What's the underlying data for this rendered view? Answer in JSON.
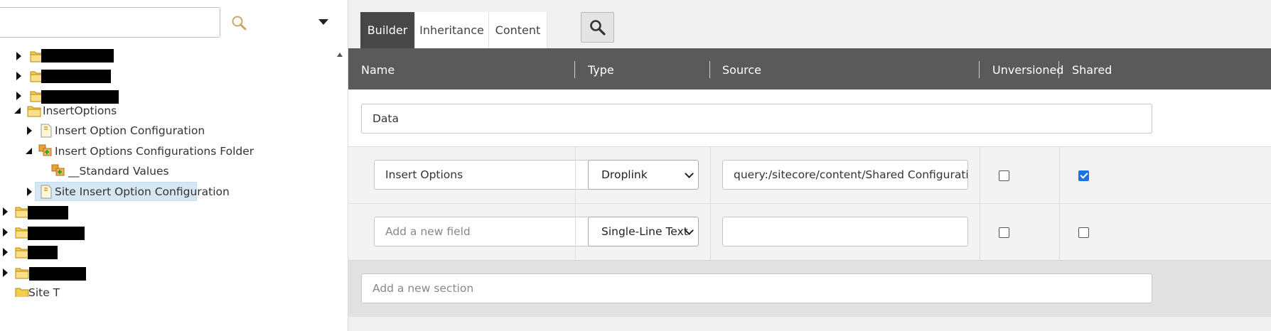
{
  "tree": {
    "search": {
      "value": "",
      "placeholder": ""
    },
    "items": [
      {
        "label": "",
        "redacted": true,
        "expanded": false
      },
      {
        "label": "",
        "redacted": true,
        "expanded": false
      },
      {
        "label": "",
        "redacted": true,
        "expanded": false
      },
      {
        "label": "InsertOptions",
        "redacted": false,
        "expanded": true
      },
      {
        "label": "Insert Option Configuration",
        "redacted": false,
        "expanded": false
      },
      {
        "label": "Insert Options Configurations Folder",
        "redacted": false,
        "expanded": true
      },
      {
        "label": "__Standard Values",
        "redacted": false,
        "expanded": false
      },
      {
        "label": "Site Insert Option Configuration",
        "redacted": false,
        "expanded": false,
        "selected": true
      },
      {
        "label": "",
        "redacted": true,
        "expanded": false
      },
      {
        "label": "",
        "redacted": true,
        "expanded": false
      },
      {
        "label": "",
        "redacted": true,
        "expanded": false
      },
      {
        "label": "",
        "redacted": true,
        "expanded": false
      },
      {
        "label": "Site T",
        "redacted": false,
        "expanded": false,
        "partial": true
      }
    ]
  },
  "tabs": [
    {
      "label": "Builder",
      "active": true
    },
    {
      "label": "Inheritance",
      "active": false
    },
    {
      "label": "Content",
      "active": false
    }
  ],
  "grid": {
    "columns": {
      "name": "Name",
      "type": "Type",
      "source": "Source",
      "unversioned": "Unversioned",
      "shared": "Shared"
    },
    "section": {
      "name": "Data"
    },
    "fields": [
      {
        "name": "Insert Options",
        "type": "Droplink",
        "source": "query:/sitecore/content/Shared Configuration/Head",
        "unversioned": false,
        "shared": true
      },
      {
        "name": "",
        "name_placeholder": "Add a new field",
        "type": "Single-Line Text",
        "source": "",
        "unversioned": false,
        "shared": false
      }
    ],
    "new_section_placeholder": "Add a new section"
  },
  "colors": {
    "header_bg": "#5a5a5a",
    "active_tab_bg": "#474747",
    "selected_tree_bg": "#d6e7f4",
    "checkbox_checked": "#1a73e8",
    "folder_yellow": "#e8b923"
  }
}
